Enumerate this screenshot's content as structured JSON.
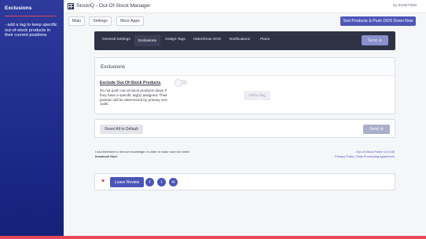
{
  "sidebar": {
    "title": "Exclusions",
    "description": "- add a tag to keep specific out-of-stock products in their current positions"
  },
  "header": {
    "title": "StockIQ - Out-Of-Stock  Manager",
    "by": "by EGNITION"
  },
  "toolbar": {
    "main": "Main",
    "settings": "Settings",
    "more_apps": "More Apps",
    "sort_push": "Sort Products & Push OOS Down Now"
  },
  "tabs": {
    "items": [
      "General Settings",
      "Exclusions",
      "Assign Tags",
      "Hide/Show OOS",
      "Notifications",
      "Plans"
    ],
    "active": "Exclusions",
    "send": "Send"
  },
  "card": {
    "title": "Exclusions",
    "section_title": "Exclude Out-Of-Stock Products",
    "description": "Do not push out-of-stock products down if they have a specific tag(s) assigned. Their position will be determined by primary sort order.",
    "add_tag": "Add a Tag"
  },
  "actions": {
    "reset": "Reset All to Default",
    "send": "Send"
  },
  "footer": {
    "quote": "I had therefore to remove knowledge, in order to make room for belief.",
    "author": "Immanuel Kant",
    "version_link": "Out-of-Stock-Police V.2.6.58",
    "policy_links": "Privacy Policy | Data Processing Agreement"
  },
  "review": {
    "leave_review": "Leave Review"
  },
  "colors": {
    "sidebar": "#1d2a8a",
    "accent": "#4d56b8",
    "tabs_bg": "#2e3245",
    "red": "#e34a5a"
  }
}
